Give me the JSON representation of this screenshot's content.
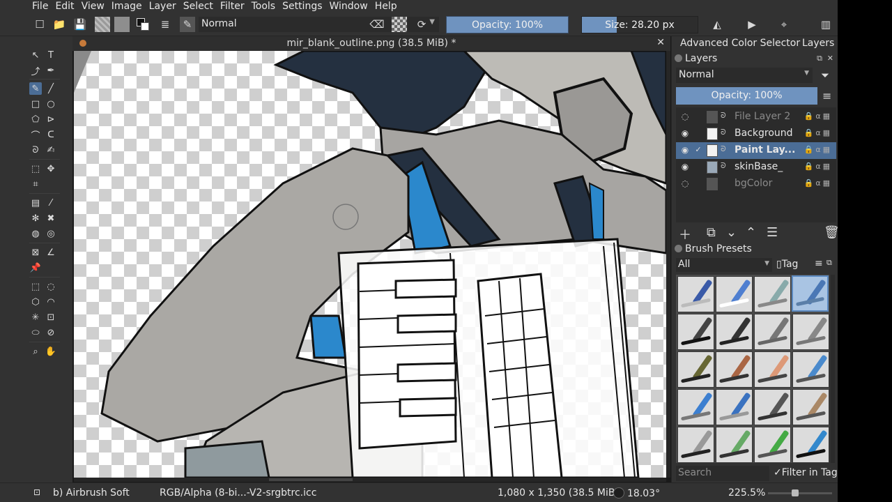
{
  "menu": [
    "File",
    "Edit",
    "View",
    "Image",
    "Layer",
    "Select",
    "Filter",
    "Tools",
    "Settings",
    "Window",
    "Help"
  ],
  "toolbar": {
    "blend_mode": "Normal",
    "opacity_label": "Opacity: 100%",
    "opacity_value": 1.0,
    "size_label": "Size: 28.20 px",
    "size_fill": 0.3
  },
  "document": {
    "tab_title": "mir_blank_outline.png (38.5 MiB) *"
  },
  "dock": {
    "tabs": [
      "Advanced Color Selector",
      "Layers"
    ],
    "layers_title": "Layers",
    "blend_mode": "Normal",
    "opacity_label": "Opacity:  100%",
    "layers": [
      {
        "name": "File Layer 2",
        "visible": false,
        "selected": false,
        "dim": true
      },
      {
        "name": "Background",
        "visible": true,
        "selected": false,
        "dim": false
      },
      {
        "name": "Paint Lay...",
        "visible": true,
        "selected": true,
        "dim": false
      },
      {
        "name": "skinBase_",
        "visible": true,
        "selected": false,
        "dim": false
      },
      {
        "name": "bgColor",
        "visible": false,
        "selected": false,
        "dim": true
      }
    ],
    "brush_presets_title": "Brush Presets",
    "preset_filter": "All",
    "tag_label": "Tag",
    "search_placeholder": "Search",
    "filter_in_tag": "Filter in Tag"
  },
  "status": {
    "brush": "b) Airbrush Soft",
    "color_profile": "RGB/Alpha (8-bi...-V2-srgbtrc.icc",
    "image_size": "1,080 x 1,350 (38.5 MiB)",
    "rotation": "18.03°",
    "zoom": "225.5%"
  },
  "colors": {
    "accent": "#6f93bf",
    "selection": "#4b6d96",
    "panel": "#323232",
    "dark": "#2b2b2b"
  }
}
